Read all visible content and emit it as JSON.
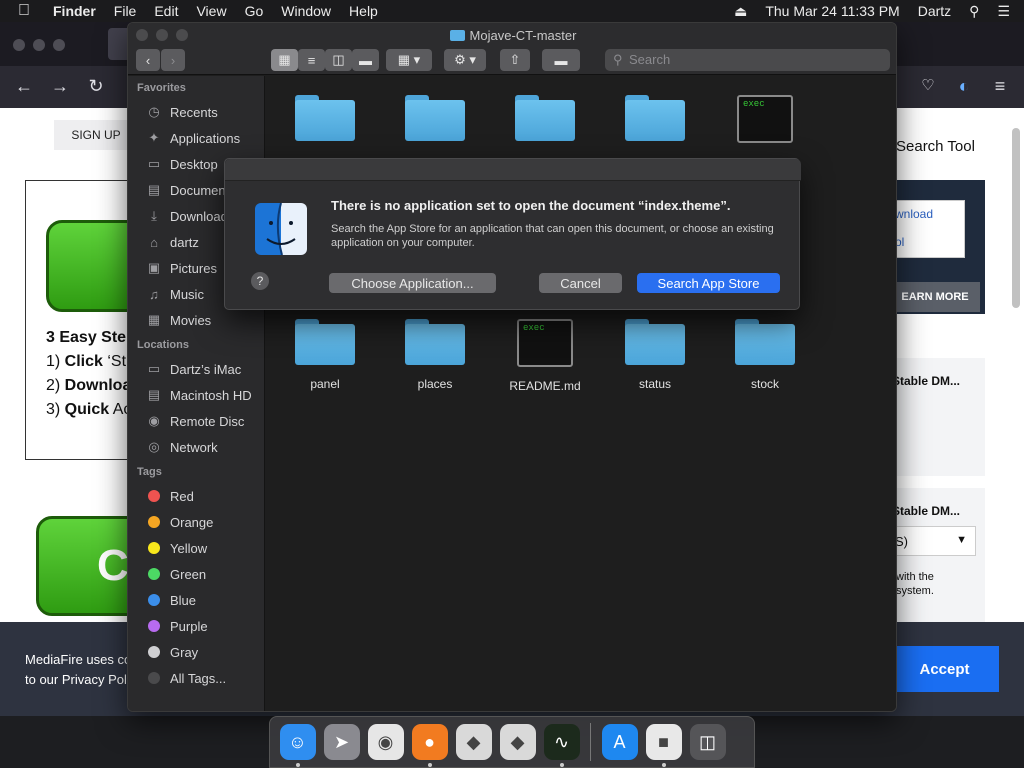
{
  "menubar": {
    "apple": "",
    "app": "Finder",
    "items": [
      "File",
      "Edit",
      "View",
      "Go",
      "Window",
      "Help"
    ],
    "clock": "Thu Mar 24  11:33 PM",
    "user": "Dartz"
  },
  "browser": {
    "webpage": {
      "signup": "SIGN UP",
      "steps_title": "3 Easy Ste",
      "step1_pre": "1) ",
      "step1_bold": "Click",
      "step1_rest": " ‘St",
      "step2_pre": "2) ",
      "step2_bold": "Downloa",
      "step3_pre": "3) ",
      "step3_bold": "Quick",
      "step3_rest": " Ac",
      "big_button_text": "Co",
      "right_title": "Search Tool",
      "link1": "wnload",
      "link2": "ol",
      "learn_more": "EARN MORE",
      "card1": "Stable DM...",
      "card2": "Stable DM...",
      "select_value": "S)",
      "small1": "with the",
      "small2": "system."
    },
    "cookie": {
      "line1": "MediaFire uses co",
      "line2": "to our Privacy Pol",
      "accept": "Accept"
    }
  },
  "finder": {
    "title": "Mojave-CT-master",
    "search_placeholder": "Search",
    "sidebar": {
      "favorites_header": "Favorites",
      "favorites": [
        {
          "label": "Recents",
          "icon": "clock-icon"
        },
        {
          "label": "Applications",
          "icon": "applications-icon"
        },
        {
          "label": "Desktop",
          "icon": "desktop-icon"
        },
        {
          "label": "Documents",
          "icon": "documents-icon"
        },
        {
          "label": "Downloads",
          "icon": "downloads-icon"
        },
        {
          "label": "dartz",
          "icon": "home-icon"
        },
        {
          "label": "Pictures",
          "icon": "pictures-icon"
        },
        {
          "label": "Music",
          "icon": "music-icon"
        },
        {
          "label": "Movies",
          "icon": "movies-icon"
        }
      ],
      "locations_header": "Locations",
      "locations": [
        {
          "label": "Dartz’s iMac",
          "icon": "imac-icon"
        },
        {
          "label": "Macintosh HD",
          "icon": "hard-drive-icon"
        },
        {
          "label": "Remote Disc",
          "icon": "disc-icon"
        },
        {
          "label": "Network",
          "icon": "network-icon"
        }
      ],
      "tags_header": "Tags",
      "tags": [
        {
          "label": "Red",
          "color": "#ef5350"
        },
        {
          "label": "Orange",
          "color": "#f5a623"
        },
        {
          "label": "Yellow",
          "color": "#f8e71c"
        },
        {
          "label": "Green",
          "color": "#4cd964"
        },
        {
          "label": "Blue",
          "color": "#3b8eea"
        },
        {
          "label": "Purple",
          "color": "#b86bf0"
        },
        {
          "label": "Gray",
          "color": "#cfcfd2"
        },
        {
          "label": "All Tags...",
          "color": "#4a4a4c"
        }
      ]
    },
    "files_row1": [
      {
        "type": "folder",
        "label": ""
      },
      {
        "type": "folder",
        "label": ""
      },
      {
        "type": "folder",
        "label": ""
      },
      {
        "type": "folder",
        "label": ""
      },
      {
        "type": "exec",
        "label": ""
      }
    ],
    "files_row2": [
      {
        "type": "folder",
        "label": "panel"
      },
      {
        "type": "folder",
        "label": "places"
      },
      {
        "type": "exec",
        "label": "README.md"
      },
      {
        "type": "folder",
        "label": "status"
      },
      {
        "type": "folder",
        "label": "stock"
      }
    ],
    "exec_text": "exec"
  },
  "dialog": {
    "title": "There is no application set to open the document “index.theme”.",
    "message": "Search the App Store for an application that can open this document, or choose an existing application on your computer.",
    "help": "?",
    "choose_button": "Choose Application...",
    "cancel_button": "Cancel",
    "search_button": "Search App Store"
  },
  "dock": {
    "apps": [
      {
        "name": "finder-icon",
        "color": "#2f8ef0",
        "running": true
      },
      {
        "name": "launchpad-icon",
        "color": "#8a8a90",
        "running": false
      },
      {
        "name": "chrome-icon",
        "color": "#e6e6e6",
        "running": false
      },
      {
        "name": "firefox-icon",
        "color": "#f27b20",
        "running": true
      },
      {
        "name": "roblox-icon",
        "color": "#d9d9d9",
        "running": false
      },
      {
        "name": "roblox-studio-icon",
        "color": "#d9d9d9",
        "running": false
      },
      {
        "name": "activity-monitor-icon",
        "color": "#1c2a1c",
        "running": true
      },
      {
        "name": "app-store-icon",
        "color": "#1e88f0",
        "running": false
      },
      {
        "name": "installer-icon",
        "color": "#e8e8e8",
        "running": true
      },
      {
        "name": "trash-icon",
        "color": "#555558",
        "running": false
      }
    ]
  }
}
